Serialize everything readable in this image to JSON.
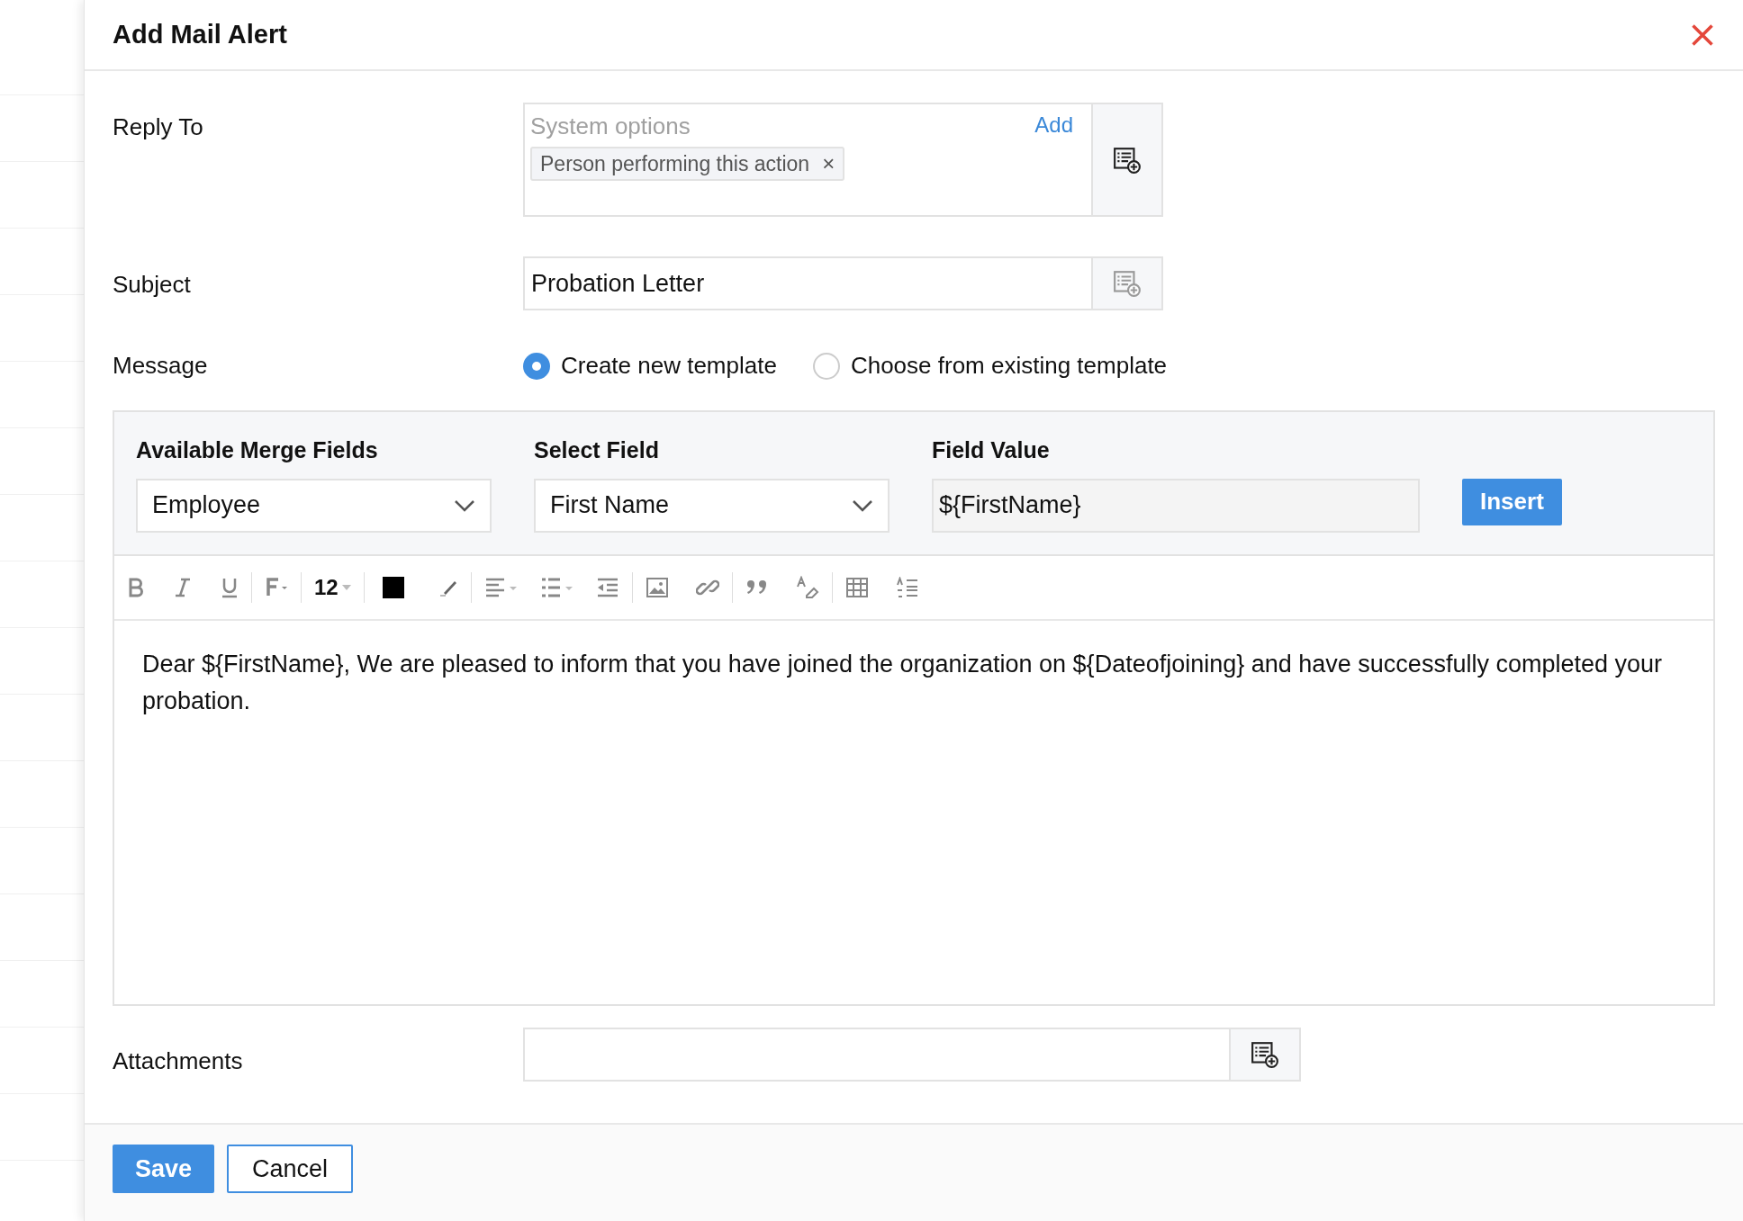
{
  "dialog": {
    "title": "Add Mail Alert"
  },
  "reply_to": {
    "label": "Reply To",
    "placeholder": "System options",
    "add_link": "Add",
    "tags": [
      {
        "label": "Person performing this action",
        "remove": "×"
      }
    ]
  },
  "subject": {
    "label": "Subject",
    "value": "Probation Letter"
  },
  "message": {
    "label": "Message",
    "options": [
      {
        "label": "Create new template",
        "selected": true
      },
      {
        "label": "Choose from existing template",
        "selected": false
      }
    ]
  },
  "merge_fields": {
    "available": {
      "label": "Available Merge Fields",
      "value": "Employee"
    },
    "select_field": {
      "label": "Select Field",
      "value": "First Name"
    },
    "field_value": {
      "label": "Field Value",
      "value": "${FirstName}"
    },
    "insert_button": "Insert"
  },
  "toolbar": {
    "font_size": "12"
  },
  "editor": {
    "content": "Dear ${FirstName}, We are pleased to inform that you have joined the organization on ${Dateofjoining} and have successfully completed your probation."
  },
  "attachments": {
    "label": "Attachments"
  },
  "buttons": [
    {
      "label": "Save",
      "kind": "primary"
    },
    {
      "label": "Cancel",
      "kind": "secondary"
    }
  ]
}
